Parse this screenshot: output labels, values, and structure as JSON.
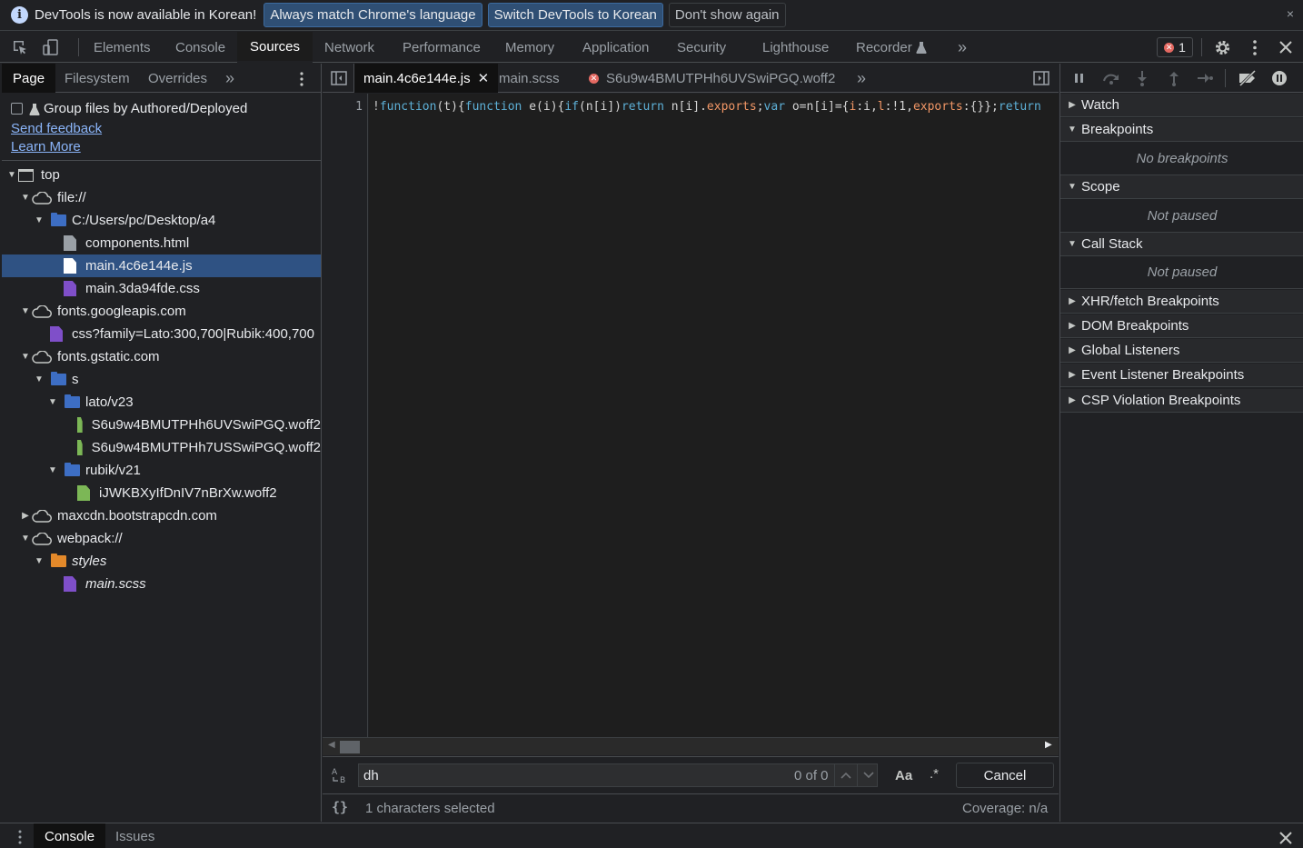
{
  "infobar": {
    "message": "DevTools is now available in Korean!",
    "btn_match": "Always match Chrome's language",
    "btn_switch": "Switch DevTools to Korean",
    "btn_dismiss": "Don't show again",
    "close": "×"
  },
  "main_tabs": [
    "Elements",
    "Console",
    "Sources",
    "Network",
    "Performance",
    "Memory",
    "Application",
    "Security",
    "Lighthouse",
    "Recorder"
  ],
  "error_count": "1",
  "navigator": {
    "tabs": [
      "Page",
      "Filesystem",
      "Overrides"
    ],
    "group_label": "Group files by Authored/Deployed",
    "send_feedback": "Send feedback",
    "learn_more": "Learn More",
    "tree": [
      {
        "label": "top"
      },
      {
        "label": "file://"
      },
      {
        "label": "C:/Users/pc/Desktop/a4"
      },
      {
        "label": "components.html"
      },
      {
        "label": "main.4c6e144e.js"
      },
      {
        "label": "main.3da94fde.css"
      },
      {
        "label": "fonts.googleapis.com"
      },
      {
        "label": "css?family=Lato:300,700|Rubik:400,700"
      },
      {
        "label": "fonts.gstatic.com"
      },
      {
        "label": "s"
      },
      {
        "label": "lato/v23"
      },
      {
        "label": "S6u9w4BMUTPHh6UVSwiPGQ.woff2"
      },
      {
        "label": "S6u9w4BMUTPHh7USSwiPGQ.woff2"
      },
      {
        "label": "rubik/v21"
      },
      {
        "label": "iJWKBXyIfDnIV7nBrXw.woff2"
      },
      {
        "label": "maxcdn.bootstrapcdn.com"
      },
      {
        "label": "webpack://"
      },
      {
        "label": "styles"
      },
      {
        "label": "main.scss"
      }
    ]
  },
  "editor": {
    "tabs": [
      "main.4c6e144e.js",
      "main.scss",
      "S6u9w4BMUTPHh6UVSwiPGQ.woff2"
    ],
    "line_number": "1",
    "search_value": "dh",
    "search_count": "0 of 0",
    "match_case": "Aa",
    "regex": ".*",
    "cancel": "Cancel",
    "status_selected": "1 characters selected",
    "coverage": "Coverage: n/a"
  },
  "debugger": {
    "watch": "Watch",
    "breakpoints": "Breakpoints",
    "no_breakpoints": "No breakpoints",
    "scope": "Scope",
    "not_paused_1": "Not paused",
    "call_stack": "Call Stack",
    "not_paused_2": "Not paused",
    "xhr": "XHR/fetch Breakpoints",
    "dom": "DOM Breakpoints",
    "global": "Global Listeners",
    "event": "Event Listener Breakpoints",
    "csp": "CSP Violation Breakpoints"
  },
  "drawer": {
    "tabs": [
      "Console",
      "Issues"
    ]
  },
  "colors": {
    "selected_row": "#2f5283",
    "link": "#8ab4f8",
    "error": "#e46962"
  }
}
